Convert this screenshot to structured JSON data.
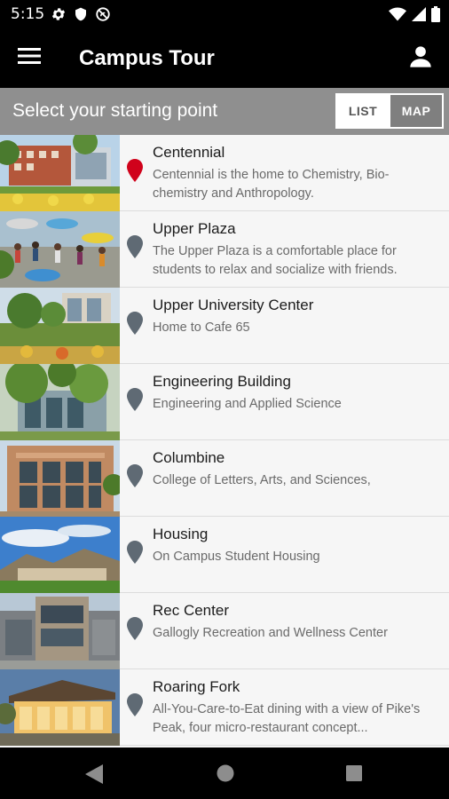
{
  "status_bar": {
    "time": "5:15",
    "icons_left": [
      "settings-gear-icon",
      "shield-icon",
      "no-disturb-icon"
    ],
    "icons_right": [
      "wifi-icon",
      "signal-icon",
      "battery-icon"
    ]
  },
  "app_bar": {
    "title": "Campus Tour",
    "menu_icon": "hamburger-menu-icon",
    "account_icon": "account-person-icon"
  },
  "sub_header": {
    "title": "Select your starting point",
    "toggle": {
      "list_label": "LIST",
      "map_label": "MAP",
      "selected": "LIST"
    }
  },
  "colors": {
    "active_pin": "#d0021b",
    "inactive_pin": "#5f6a74",
    "header_gray": "#8f8f8f"
  },
  "tour_stops": [
    {
      "title": "Centennial",
      "description": "Centennial is the home to Chemistry, Bio-chemistry and Anthropology.",
      "active": true
    },
    {
      "title": "Upper Plaza",
      "description": "The Upper Plaza is a comfortable place for students to relax and socialize with friends.",
      "active": false
    },
    {
      "title": "Upper University Center",
      "description": "Home to Cafe 65",
      "active": false
    },
    {
      "title": "Engineering Building",
      "description": "Engineering and Applied Science",
      "active": false
    },
    {
      "title": "Columbine",
      "description": "College of Letters, Arts, and Sciences,",
      "active": false
    },
    {
      "title": "Housing",
      "description": "On Campus Student Housing",
      "active": false
    },
    {
      "title": "Rec Center",
      "description": "Gallogly Recreation and Wellness Center",
      "active": false
    },
    {
      "title": "Roaring Fork",
      "description": "All-You-Care-to-Eat dining with a view of Pike's Peak, four micro-restaurant concept...",
      "active": false
    }
  ],
  "nav_bar": {
    "icons": [
      "back-icon",
      "home-icon",
      "recents-icon"
    ]
  }
}
